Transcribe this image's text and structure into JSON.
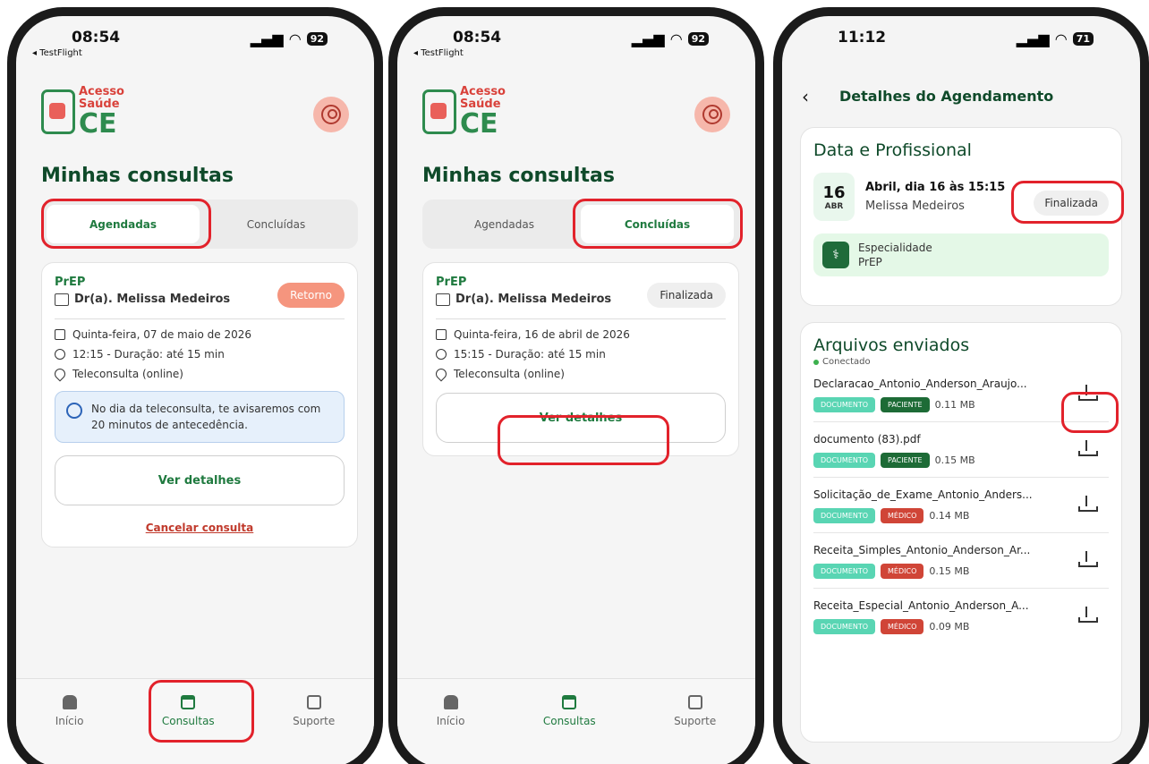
{
  "status_left": {
    "time": "08:54",
    "testflight": "◂ TestFlight",
    "battery": "92"
  },
  "status_mid": {
    "time": "08:54",
    "testflight": "◂ TestFlight",
    "battery": "92"
  },
  "status_right": {
    "time": "11:12",
    "battery": "71"
  },
  "logo": {
    "line1": "Acesso",
    "line2": "Saúde",
    "line3": "CE"
  },
  "page_title": "Minhas consultas",
  "tabs": {
    "scheduled": "Agendadas",
    "completed": "Concluídas"
  },
  "card_scheduled": {
    "specialty": "PrEP",
    "doctor": "Dr(a). Melissa Medeiros",
    "badge": "Retorno",
    "date": "Quinta-feira, 07 de maio de 2026",
    "time": "12:15 - Duração: até 15 min",
    "location": "Teleconsulta (online)",
    "notice": "No dia da teleconsulta, te avisaremos com 20 minutos de antecedência.",
    "details_button": "Ver detalhes",
    "cancel_link": "Cancelar consulta"
  },
  "card_completed": {
    "specialty": "PrEP",
    "doctor": "Dr(a). Melissa Medeiros",
    "badge": "Finalizada",
    "date": "Quinta-feira, 16 de abril de 2026",
    "time": "15:15 - Duração: até 15 min",
    "location": "Teleconsulta (online)",
    "details_button": "Ver detalhes"
  },
  "bottom_nav": {
    "home": "Início",
    "appointments": "Consultas",
    "support": "Suporte"
  },
  "details": {
    "header": "Detalhes do Agendamento",
    "section_title": "Data e Profissional",
    "day": "16",
    "month": "ABR",
    "datetime": "Abril, dia 16 às 15:15",
    "professional": "Melissa Medeiros",
    "status": "Finalizada",
    "specialty_label": "Especialidade",
    "specialty_value": "PrEP",
    "files_title": "Arquivos enviados",
    "connection": "Conectado",
    "files": [
      {
        "name": "Declaracao_Antonio_Anderson_Araujo...",
        "type": "DOCUMENTO",
        "owner": "PACIENTE",
        "size": "0.11 MB"
      },
      {
        "name": "documento (83).pdf",
        "type": "DOCUMENTO",
        "owner": "PACIENTE",
        "size": "0.15 MB"
      },
      {
        "name": "Solicitação_de_Exame_Antonio_Anders...",
        "type": "DOCUMENTO",
        "owner": "MÉDICO",
        "size": "0.14 MB"
      },
      {
        "name": "Receita_Simples_Antonio_Anderson_Ar...",
        "type": "DOCUMENTO",
        "owner": "MÉDICO",
        "size": "0.15 MB"
      },
      {
        "name": "Receita_Especial_Antonio_Anderson_A...",
        "type": "DOCUMENTO",
        "owner": "MÉDICO",
        "size": "0.09 MB"
      }
    ]
  },
  "colors": {
    "brand_green": "#1f7a3f",
    "highlight_red": "#e2222b",
    "retorno": "#f5957e"
  }
}
